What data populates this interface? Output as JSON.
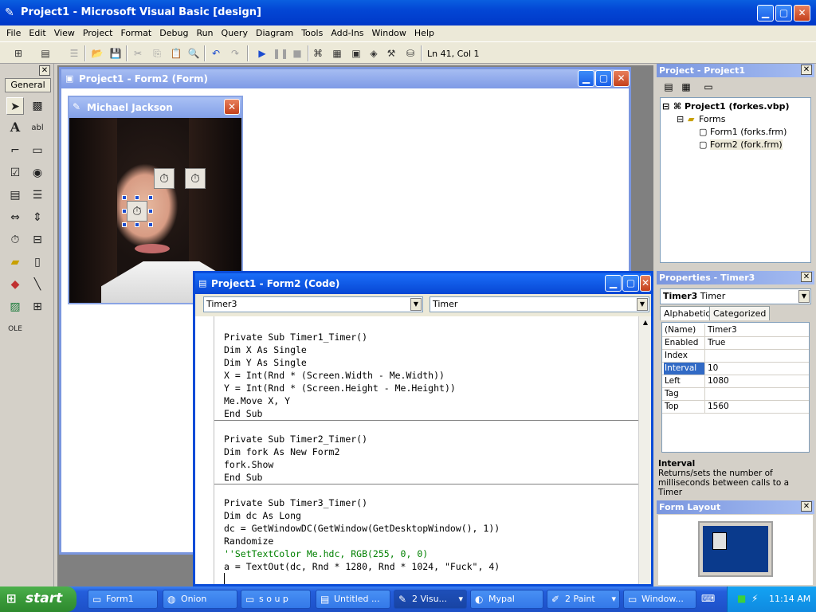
{
  "window": {
    "title": "Project1 - Microsoft Visual Basic [design]"
  },
  "menu": [
    "File",
    "Edit",
    "View",
    "Project",
    "Format",
    "Debug",
    "Run",
    "Query",
    "Diagram",
    "Tools",
    "Add-Ins",
    "Window",
    "Help"
  ],
  "toolbar": {
    "status": "Ln 41, Col 1"
  },
  "toolbox": {
    "tab_label": "General"
  },
  "form_window": {
    "title": "Project1 - Form2 (Form)"
  },
  "mj_window": {
    "title": "Michael Jackson"
  },
  "code_window": {
    "title": "Project1 - Form2 (Code)",
    "object_combo": "Timer3",
    "proc_combo": "Timer",
    "blocks": [
      [
        "Private Sub Timer1_Timer()",
        "Dim X As Single",
        "Dim Y As Single",
        "X = Int(Rnd * (Screen.Width - Me.Width))",
        "Y = Int(Rnd * (Screen.Height - Me.Height))",
        "Me.Move X, Y",
        "End Sub"
      ],
      [
        "Private Sub Timer2_Timer()",
        "Dim fork As New Form2",
        "fork.Show",
        "End Sub"
      ],
      [
        "Private Sub Timer3_Timer()",
        "Dim dc As Long",
        "dc = GetWindowDC(GetWindow(GetDesktopWindow(), 1))",
        "Randomize",
        "''SetTextColor Me.hdc, RGB(255, 0, 0)",
        "a = TextOut(dc, Rnd * 1280, Rnd * 1024, \"Fuck\", 4)"
      ]
    ]
  },
  "project_panel": {
    "title": "Project - Project1",
    "root": "Project1 (forkes.vbp)",
    "folder": "Forms",
    "items": [
      "Form1 (forks.frm)",
      "Form2 (fork.frm)"
    ]
  },
  "properties_panel": {
    "title": "Properties - Timer3",
    "object_name": "Timer3",
    "object_type": "Timer",
    "tabs": [
      "Alphabetic",
      "Categorized"
    ],
    "rows": [
      {
        "name": "(Name)",
        "value": "Timer3"
      },
      {
        "name": "Enabled",
        "value": "True"
      },
      {
        "name": "Index",
        "value": ""
      },
      {
        "name": "Interval",
        "value": "10"
      },
      {
        "name": "Left",
        "value": "1080"
      },
      {
        "name": "Tag",
        "value": ""
      },
      {
        "name": "Top",
        "value": "1560"
      }
    ],
    "desc_title": "Interval",
    "desc_text": "Returns/sets the number of milliseconds between calls to a Timer"
  },
  "form_layout_panel": {
    "title": "Form Layout"
  },
  "taskbar": {
    "start_label": "start",
    "tasks": [
      "Form1",
      "Onion",
      "s o u p",
      "Untitled ...",
      "2 Visu...",
      "Mypal",
      "2 Paint",
      "Window..."
    ],
    "clock": "11:14 AM"
  }
}
